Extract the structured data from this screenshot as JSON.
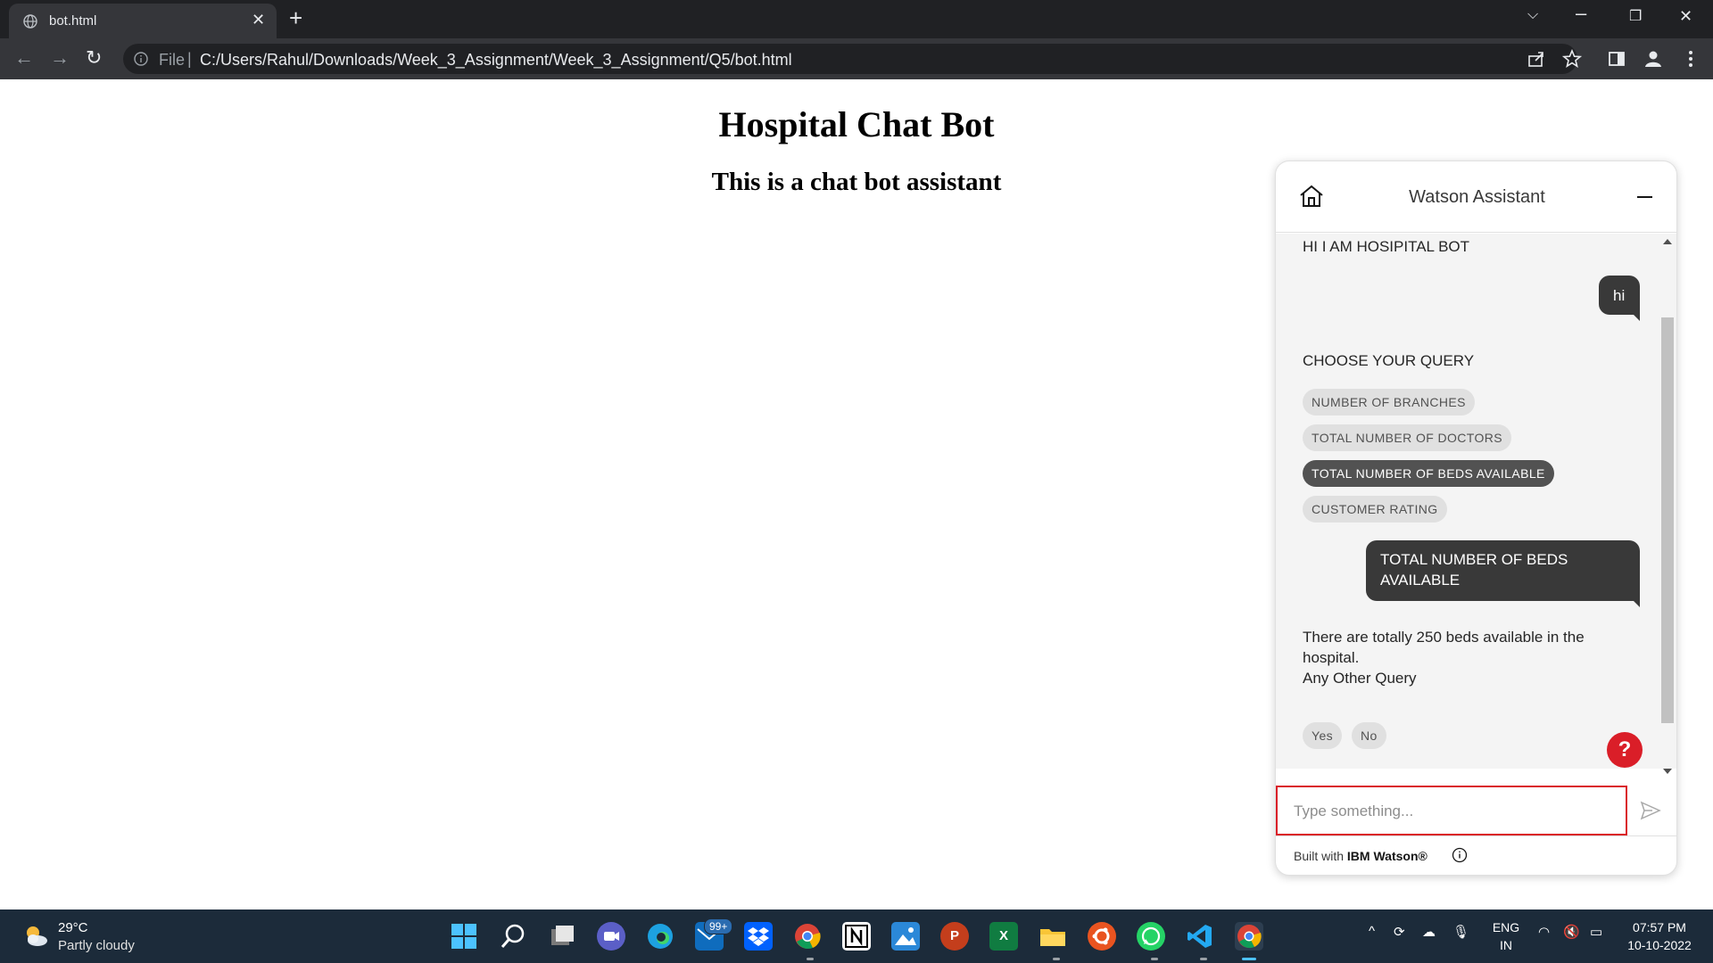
{
  "browser": {
    "tab_title": "bot.html",
    "file_label": "File",
    "separator": "|",
    "url": "C:/Users/Rahul/Downloads/Week_3_Assignment/Week_3_Assignment/Q5/bot.html"
  },
  "page": {
    "title": "Hospital Chat Bot",
    "subtitle": "This is a chat bot assistant"
  },
  "chat": {
    "header_title": "Watson Assistant",
    "messages": {
      "greeting": "HI I AM HOSIPITAL BOT",
      "user_hi": "hi",
      "choose_query": "CHOOSE YOUR QUERY",
      "user_choice": "TOTAL NUMBER OF BEDS AVAILABLE",
      "reply_line1": "There are totally 250 beds available in the hospital.",
      "reply_line2": "Any Other Query"
    },
    "options": [
      {
        "label": "NUMBER OF BRANCHES",
        "selected": false
      },
      {
        "label": "TOTAL NUMBER OF DOCTORS",
        "selected": false
      },
      {
        "label": "TOTAL NUMBER OF BEDS AVAILABLE",
        "selected": true
      },
      {
        "label": "CUSTOMER RATING",
        "selected": false
      }
    ],
    "yes_no": [
      "Yes",
      "No"
    ],
    "help_label": "?",
    "input_placeholder": "Type something...",
    "footer_prefix": "Built with",
    "footer_brand": "IBM Watson®"
  },
  "taskbar": {
    "temperature": "29°C",
    "weather": "Partly cloudy",
    "mail_badge": "99+",
    "lang_line1": "ENG",
    "lang_line2": "IN",
    "time": "07:57 PM",
    "date": "10-10-2022"
  },
  "colors": {
    "accent_red": "#da1e28",
    "bubble_dark": "#393939",
    "chrome_dark": "#202124",
    "taskbar": "#1c2b3a"
  }
}
